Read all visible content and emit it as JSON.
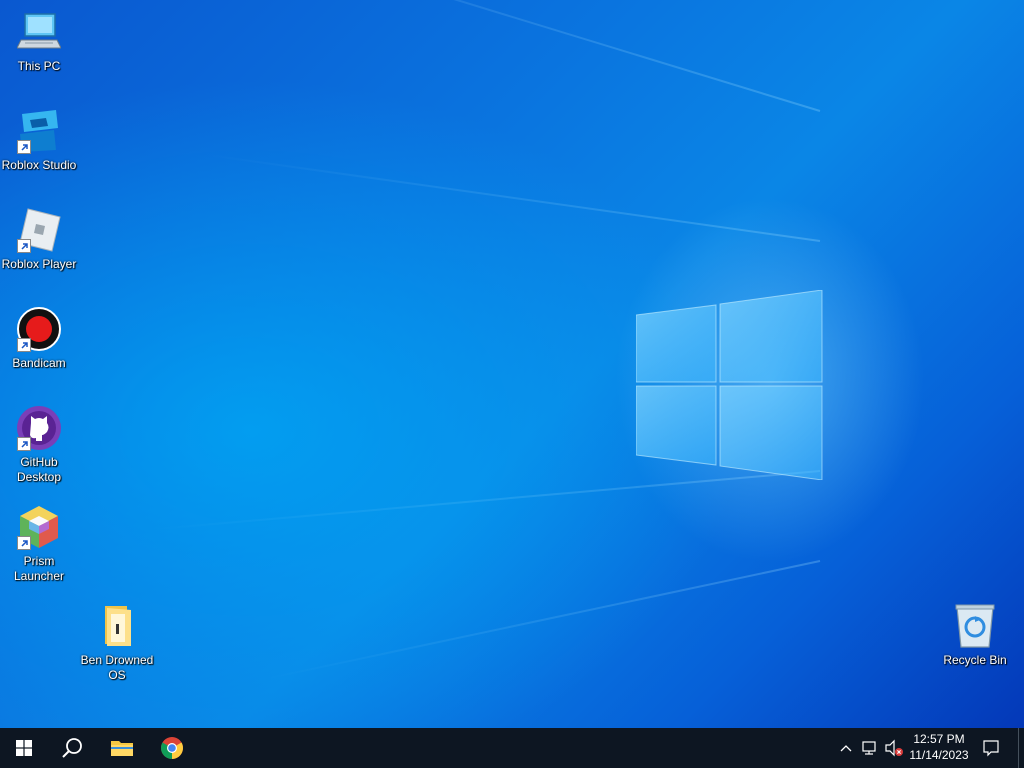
{
  "desktop": {
    "icons": [
      {
        "name": "this-pc",
        "label": "This PC",
        "icon": "computer-icon"
      },
      {
        "name": "roblox-studio",
        "label": "Roblox Studio",
        "icon": "roblox-studio-icon"
      },
      {
        "name": "roblox-player",
        "label": "Roblox Player",
        "icon": "roblox-player-icon"
      },
      {
        "name": "bandicam",
        "label": "Bandicam",
        "icon": "bandicam-icon"
      },
      {
        "name": "github-desktop",
        "label": "GitHub\nDesktop",
        "icon": "github-icon"
      },
      {
        "name": "prism-launcher",
        "label": "Prism\nLauncher",
        "icon": "prism-launcher-icon"
      },
      {
        "name": "ben-drowned-os",
        "label": "Ben Drowned\nOS",
        "icon": "folder-icon"
      },
      {
        "name": "recycle-bin",
        "label": "Recycle Bin",
        "icon": "recycle-bin-icon"
      }
    ]
  },
  "taskbar": {
    "start": "windows-start-icon",
    "search": "search-icon",
    "pinned": [
      {
        "name": "file-explorer",
        "icon": "folder-icon"
      },
      {
        "name": "chrome",
        "icon": "chrome-icon"
      }
    ],
    "tray": {
      "show_hidden": "chevron-up-icon",
      "network": "network-icon",
      "volume": "volume-muted-icon",
      "time": "12:57 PM",
      "date": "11/14/2023",
      "notifications": "action-center-icon"
    }
  },
  "colors": {
    "wallpaper": "#0a74df",
    "taskbar": "#0d1622"
  }
}
